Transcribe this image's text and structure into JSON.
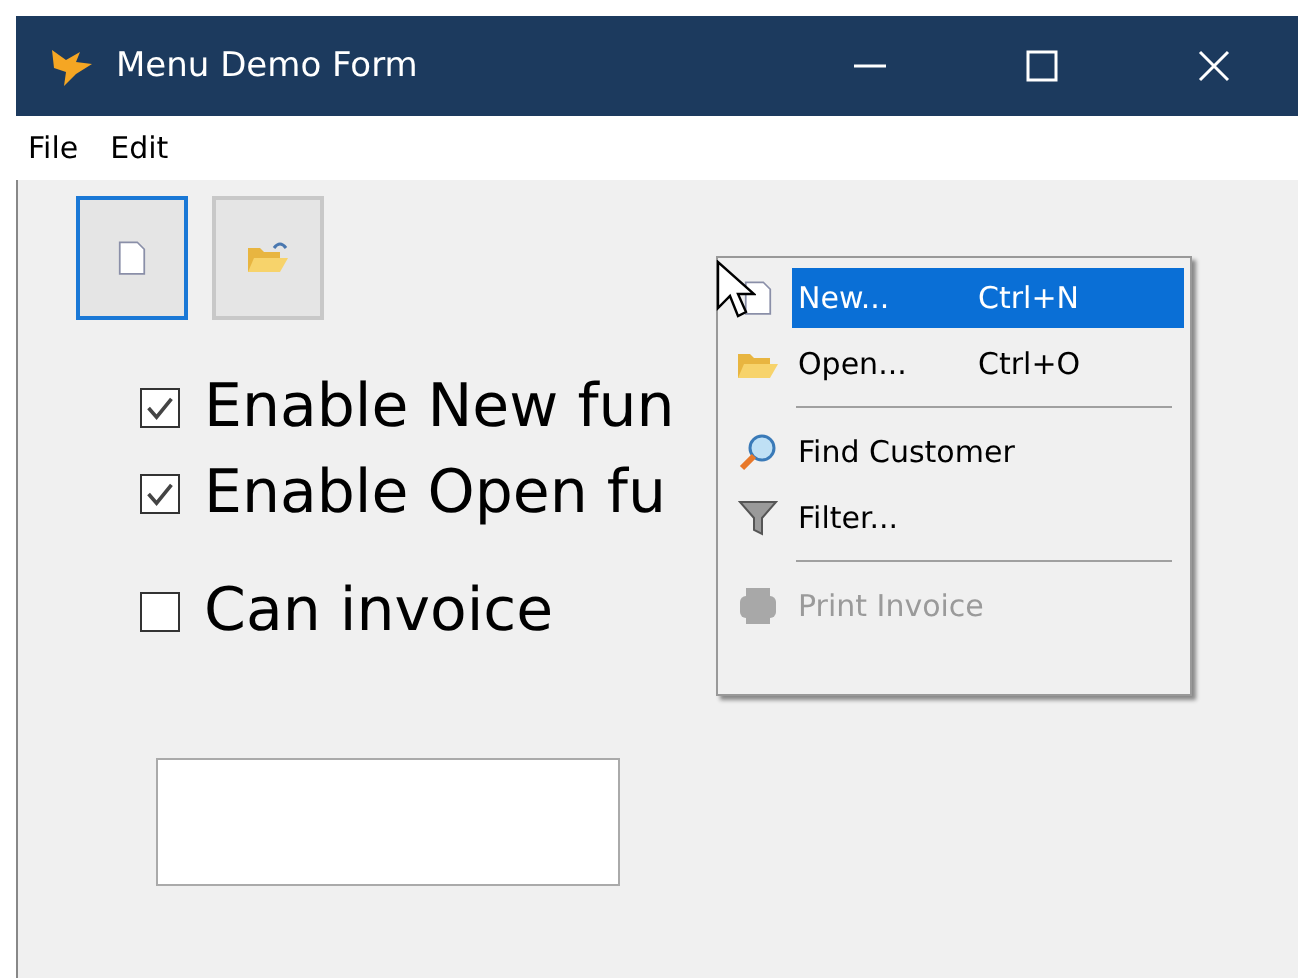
{
  "window": {
    "title": "Menu Demo Form"
  },
  "menu_bar": [
    "File",
    "Edit"
  ],
  "toolbar": [
    {
      "kind": "new",
      "focused": true
    },
    {
      "kind": "open",
      "focused": false
    }
  ],
  "checkboxes": [
    {
      "label": "Enable New fun",
      "checked": true
    },
    {
      "label": "Enable Open fu",
      "checked": true
    },
    {
      "label": "Can invoice",
      "checked": false
    }
  ],
  "context_menu": [
    {
      "kind": "new",
      "label": "New...",
      "shortcut": "Ctrl+N",
      "selected": true,
      "disabled": false
    },
    {
      "kind": "open",
      "label": "Open...",
      "shortcut": "Ctrl+O",
      "selected": false,
      "disabled": false
    },
    {
      "kind": "separator"
    },
    {
      "kind": "find",
      "label": "Find Customer",
      "selected": false,
      "disabled": false
    },
    {
      "kind": "filter",
      "label": "Filter...",
      "selected": false,
      "disabled": false
    },
    {
      "kind": "separator"
    },
    {
      "kind": "print",
      "label": "Print Invoice",
      "selected": false,
      "disabled": true
    }
  ]
}
